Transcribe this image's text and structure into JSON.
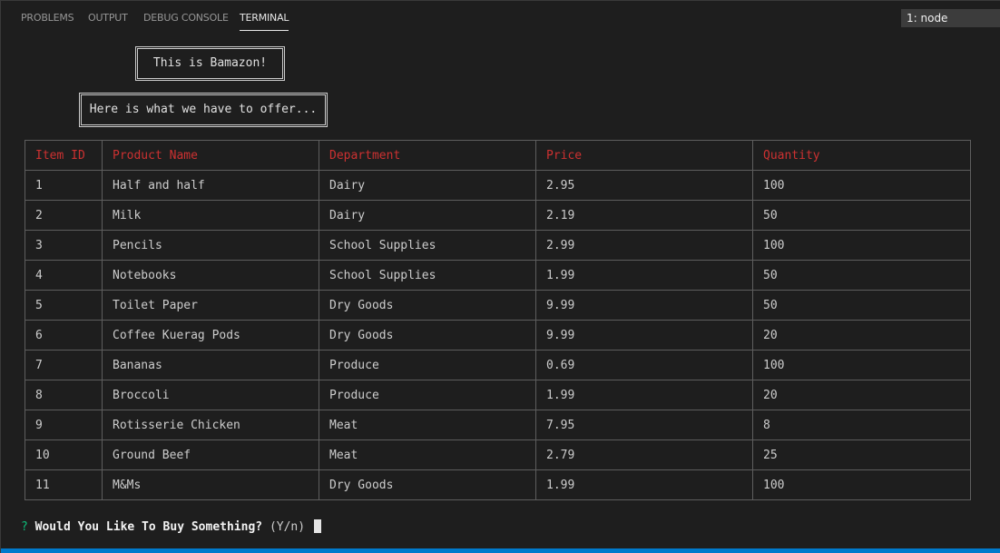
{
  "panel": {
    "tabs": [
      {
        "label": "PROBLEMS"
      },
      {
        "label": "OUTPUT"
      },
      {
        "label": "DEBUG CONSOLE"
      },
      {
        "label": "TERMINAL",
        "active": true
      }
    ],
    "terminal_select": "1: node"
  },
  "terminal": {
    "banner_title": "This is Bamazon!",
    "banner_subtitle": "Here is what we have to offer...",
    "table": {
      "headers": [
        "Item ID",
        "Product Name",
        "Department",
        "Price",
        "Quantity"
      ],
      "rows": [
        [
          "1",
          "Half and half",
          "Dairy",
          "2.95",
          "100"
        ],
        [
          "2",
          "Milk",
          "Dairy",
          "2.19",
          "50"
        ],
        [
          "3",
          "Pencils",
          "School Supplies",
          "2.99",
          "100"
        ],
        [
          "4",
          "Notebooks",
          "School Supplies",
          "1.99",
          "50"
        ],
        [
          "5",
          "Toilet Paper",
          "Dry Goods",
          "9.99",
          "50"
        ],
        [
          "6",
          "Coffee Kuerag Pods",
          "Dry Goods",
          "9.99",
          "20"
        ],
        [
          "7",
          "Bananas",
          "Produce",
          "0.69",
          "100"
        ],
        [
          "8",
          "Broccoli",
          "Produce",
          "1.99",
          "20"
        ],
        [
          "9",
          "Rotisserie Chicken",
          "Meat",
          "7.95",
          "8"
        ],
        [
          "10",
          "Ground Beef",
          "Meat",
          "2.79",
          "25"
        ],
        [
          "11",
          "M&Ms",
          "Dry Goods",
          "1.99",
          "100"
        ]
      ]
    },
    "prompt": {
      "marker": "?",
      "question": "Would You Like To Buy Something?",
      "hint": "(Y/n)"
    }
  },
  "colors": {
    "background": "#1e1e1e",
    "header_red": "#cd3131",
    "prompt_green": "#0dbc79",
    "status_blue": "#007acc"
  }
}
